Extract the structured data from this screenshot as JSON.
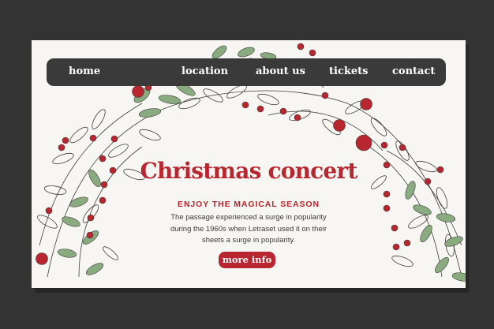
{
  "colors": {
    "background": "#333333",
    "page": "#f8f6f2",
    "navbar": "#3a3a3a",
    "accent_red": "#b8262f",
    "leaf_green": "#8aab7f",
    "line_dark": "#3d3d3d"
  },
  "nav": {
    "items": [
      {
        "id": "home",
        "label": "home"
      },
      {
        "id": "location",
        "label": "location"
      },
      {
        "id": "about",
        "label": "about us"
      },
      {
        "id": "tickets",
        "label": "tickets"
      },
      {
        "id": "contact",
        "label": "contact"
      }
    ]
  },
  "hero": {
    "title": "Christmas concert",
    "subtitle": "ENJOY THE MAGICAL SEASON",
    "body": "The passage experienced a surge in popularity during the 1960s when Letraset used it on their sheets a surge in popularity.",
    "button_label": "more info"
  },
  "decoration": {
    "icon": "holly-wreath-icon"
  }
}
